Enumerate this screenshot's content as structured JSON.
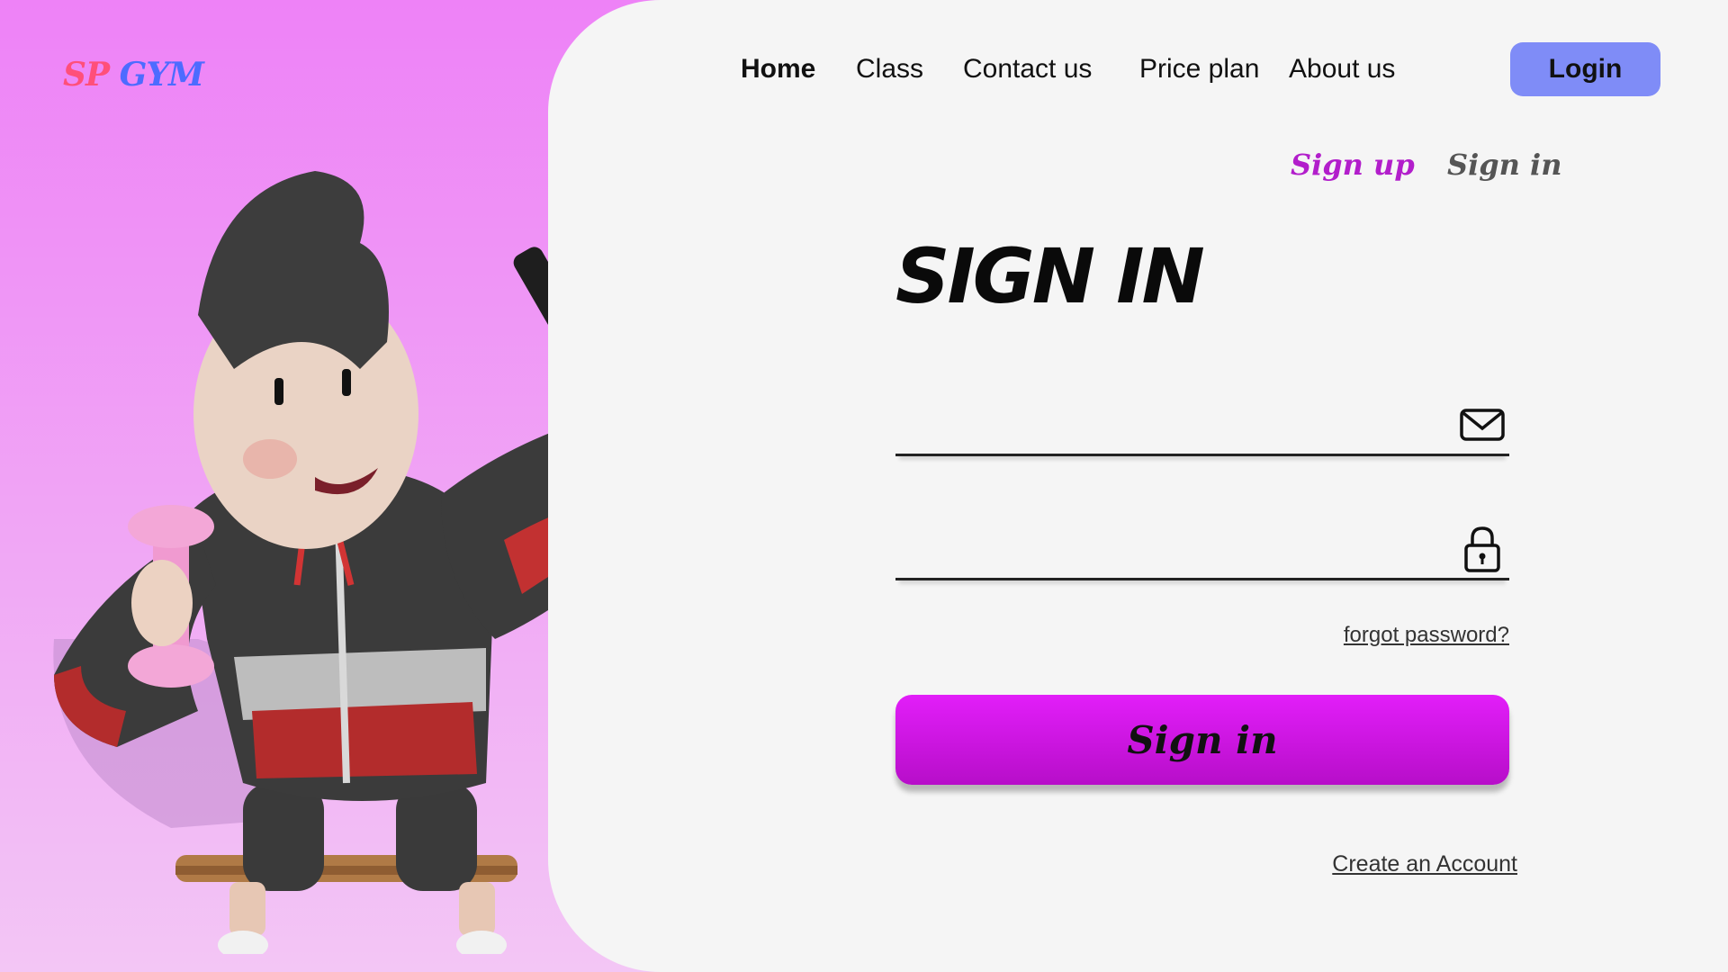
{
  "brand": {
    "logo_part1": "SP",
    "logo_part2": "GYM",
    "colors": {
      "sp": "#ff4f7a",
      "gym": "#4d6bff"
    }
  },
  "nav": {
    "items": [
      {
        "label": "Home",
        "active": true
      },
      {
        "label": "Class",
        "active": false
      },
      {
        "label": "Contact us",
        "active": false
      },
      {
        "label": "Price plan",
        "active": false
      },
      {
        "label": "About us",
        "active": false
      }
    ],
    "login_label": "Login"
  },
  "auth_tabs": {
    "signup": "Sign up",
    "signin": "Sign in"
  },
  "form": {
    "title": "SIGN IN",
    "email": {
      "value": "",
      "placeholder": "",
      "icon": "envelope-icon"
    },
    "password": {
      "value": "",
      "placeholder": "",
      "icon": "lock-icon"
    },
    "forgot_label": "forgot password?",
    "submit_label": "Sign in",
    "create_account_label": "Create an Account"
  },
  "colors": {
    "accent": "#d61af0",
    "login_button": "#7f8cf7",
    "signup_tab": "#b21ecb",
    "left_gradient_top": "#ee82f7",
    "left_gradient_bottom": "#f3c6f5",
    "panel": "#f5f5f5"
  },
  "illustration": {
    "icon": "gym-character-selfie-illustration"
  }
}
